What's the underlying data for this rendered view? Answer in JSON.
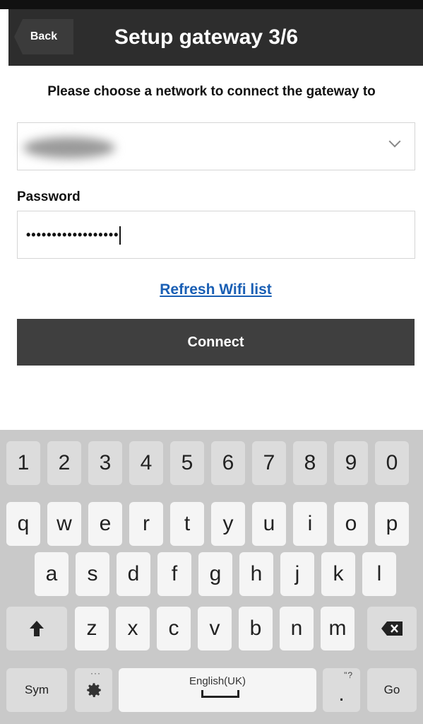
{
  "header": {
    "back_label": "Back",
    "title": "Setup gateway 3/6"
  },
  "main": {
    "prompt": "Please choose a network to connect the gateway to",
    "password_label": "Password",
    "password_value": "••••••••••••••••••",
    "refresh_link": "Refresh Wifi list",
    "connect_label": "Connect"
  },
  "keyboard": {
    "numbers": [
      "1",
      "2",
      "3",
      "4",
      "5",
      "6",
      "7",
      "8",
      "9",
      "0"
    ],
    "row1": [
      "q",
      "w",
      "e",
      "r",
      "t",
      "y",
      "u",
      "i",
      "o",
      "p"
    ],
    "row2": [
      "a",
      "s",
      "d",
      "f",
      "g",
      "h",
      "j",
      "k",
      "l"
    ],
    "row3": [
      "z",
      "x",
      "c",
      "v",
      "b",
      "n",
      "m"
    ],
    "sym_label": "Sym",
    "space_label": "English(UK)",
    "period_label": ".",
    "period_hint": "\"?",
    "go_label": "Go",
    "settings_hint": "···"
  },
  "colors": {
    "header_bg": "#2d2d2d",
    "button_bg": "#3f3f3f",
    "link": "#1a5fb4",
    "keyboard_bg": "#c9c9c9"
  }
}
